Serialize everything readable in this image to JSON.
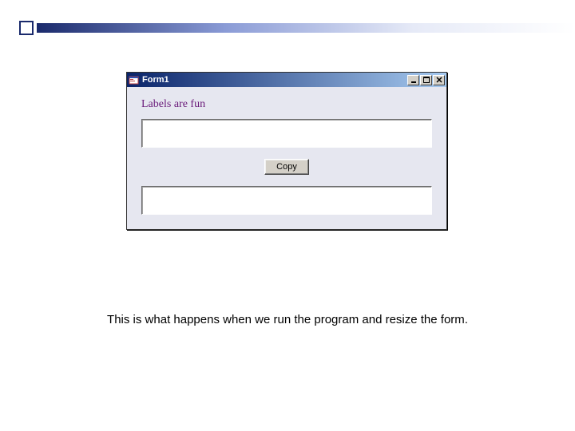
{
  "slide": {
    "caption": "This is what happens when we run the program and resize the form."
  },
  "window": {
    "title": "Form1",
    "control_buttons": {
      "minimize": "minimize",
      "maximize": "maximize",
      "close": "close"
    }
  },
  "form": {
    "label_text": "Labels are fun",
    "textbox1_value": "",
    "textbox2_value": "",
    "copy_button_label": "Copy"
  }
}
